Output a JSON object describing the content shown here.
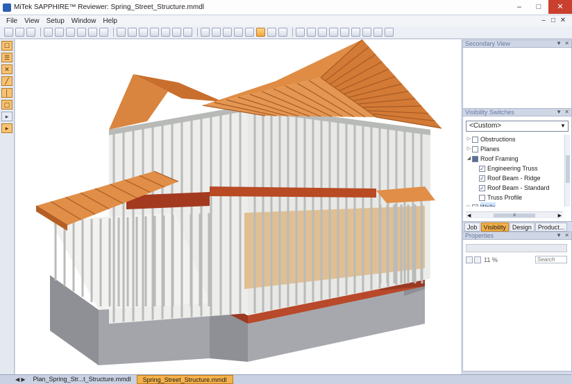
{
  "window": {
    "title": "MiTek SAPPHIRE™ Reviewer: Spring_Street_Structure.mmdl",
    "minimize": "–",
    "maximize": "□",
    "close": "✕"
  },
  "menu": [
    "File",
    "View",
    "Setup",
    "Window",
    "Help"
  ],
  "mdi_controls": [
    "–",
    "□",
    "✕"
  ],
  "toolbar": {
    "icons": [
      "new-icon",
      "save-icon",
      "print-icon",
      "zoom-in-icon",
      "zoom-out-icon",
      "zoom-window-icon",
      "zoom-fit-icon",
      "pan-icon",
      "rotate-icon",
      "view-top-icon",
      "view-front-icon",
      "view-back-icon",
      "view-left-icon",
      "view-right-icon",
      "view-iso-icon",
      "view-persp-icon",
      "solid-icon",
      "wire-icon",
      "hidden-icon",
      "shade-icon",
      "layer-icon",
      "render-icon",
      "grid-icon",
      "section-icon",
      "measure-icon",
      "note-icon",
      "note2-icon",
      "note3-icon",
      "tag-icon",
      "bulb-icon",
      "house-icon",
      "camera-icon",
      "light-icon"
    ]
  },
  "left_tools": [
    "☐",
    "☰",
    "✕",
    "╱",
    "│",
    "▢",
    "▸",
    "▸"
  ],
  "doc_tabs": {
    "nav": "◀ ▶",
    "items": [
      "Plan_Spring_Str...t_Structure.mmdl",
      "Spring_Street_Structure.mmdl"
    ],
    "active_index": 1
  },
  "panels": {
    "secondary_view": {
      "title": "Secondary View"
    },
    "visibility": {
      "title": "Visibility Switches",
      "selected": "<Custom>",
      "tree": [
        {
          "label": "Obstructions",
          "level": 1,
          "expander": "▷",
          "state": "unchecked"
        },
        {
          "label": "Planes",
          "level": 1,
          "expander": "▷",
          "state": "unchecked"
        },
        {
          "label": "Roof Framing",
          "level": 1,
          "expander": "◢",
          "state": "partial"
        },
        {
          "label": "Engineering Truss",
          "level": 2,
          "expander": "",
          "state": "checked"
        },
        {
          "label": "Roof Beam - Ridge",
          "level": 2,
          "expander": "",
          "state": "checked"
        },
        {
          "label": "Roof Beam - Standard",
          "level": 2,
          "expander": "",
          "state": "checked"
        },
        {
          "label": "Truss Profile",
          "level": 2,
          "expander": "",
          "state": "unchecked"
        },
        {
          "label": "Walls",
          "level": 1,
          "expander": "▷",
          "state": "checked",
          "selected": true
        }
      ]
    },
    "tabs": [
      "Job",
      "Visibility",
      "Design",
      "Product..."
    ],
    "active_tab": 1,
    "properties": {
      "title": "Properties",
      "zoom": "11 %",
      "search_placeholder": "Search"
    }
  },
  "colors": {
    "roof": "#d9853f",
    "stud": "#c9cbc9",
    "rim": "#b8492a",
    "foundation": "#9ea0a6",
    "active_tab": "#f5b24a"
  }
}
